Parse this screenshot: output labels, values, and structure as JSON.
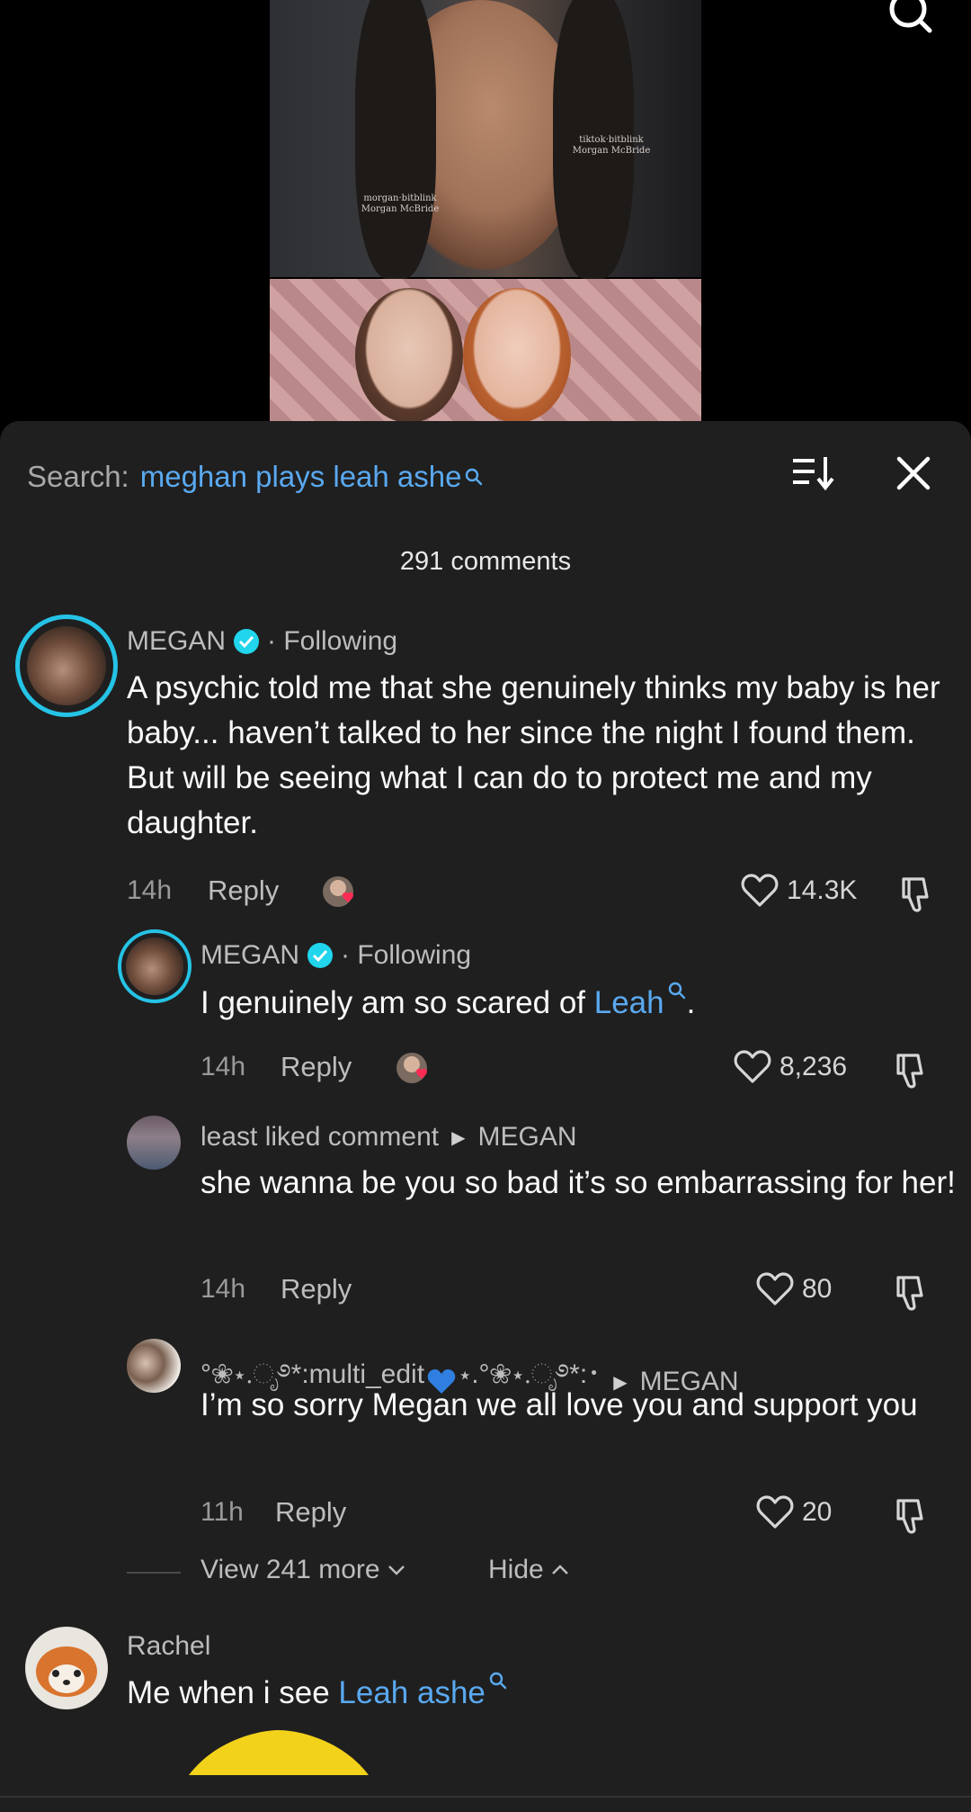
{
  "video": {
    "watermark_top": "tiktok·bitblink\nMorgan McBride",
    "watermark_mid": "morgan·bitblink\nMorgan McBride"
  },
  "search": {
    "label": "Search:",
    "query": "meghan plays leah ashe"
  },
  "comments_count": "291 comments",
  "comments": [
    {
      "name": "MEGAN",
      "following": "· Following",
      "text": "A psychic told me that she genuinely thinks my baby is her baby... haven’t talked to her since the night I found them. But will be seeing what I can do to protect me and my daughter.",
      "time": "14h",
      "reply": "Reply",
      "likes": "14.3K"
    },
    {
      "name": "MEGAN",
      "following": "· Following",
      "text_before": "I genuinely am so scared of ",
      "text_link": "Leah",
      "text_after": ".",
      "time": "14h",
      "reply": "Reply",
      "likes": "8,236"
    },
    {
      "name": "least liked comment",
      "reply_to": "MEGAN",
      "text": "she wanna be you so bad it’s so embarrassing for her!",
      "time": "14h",
      "reply": "Reply",
      "likes": "80"
    },
    {
      "name": "°❀⋆.ೃ࿔*:multi_edit",
      "name_suffix": "⋆.°❀⋆.ೃ࿔*:･",
      "reply_to": "MEGAN",
      "text": "I’m so sorry Megan we all love you and support you",
      "time": "11h",
      "reply": "Reply",
      "likes": "20"
    },
    {
      "name": "Rachel",
      "text_before": "Me when i see ",
      "text_link": "Leah ashe"
    }
  ],
  "view_more": "View 241 more",
  "hide": "Hide",
  "colors": {
    "sheet_bg": "#1f1f1f",
    "link": "#5aa9f0",
    "verified": "#20d5ec",
    "like_heart": "#fe2c55"
  }
}
